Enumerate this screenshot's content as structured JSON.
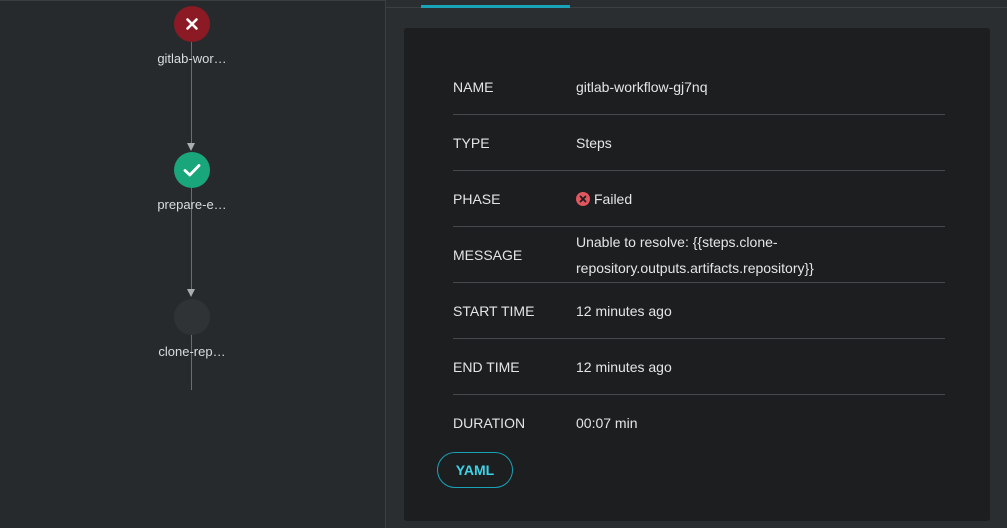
{
  "graph": {
    "nodes": [
      {
        "label": "gitlab-wor…",
        "status": "failed",
        "icon": "close-icon"
      },
      {
        "label": "prepare-e…",
        "status": "succeeded",
        "icon": "check-icon"
      },
      {
        "label": "clone-rep…",
        "status": "pending",
        "icon": "none"
      }
    ]
  },
  "details": {
    "rows": [
      {
        "key": "NAME",
        "value": "gitlab-workflow-gj7nq"
      },
      {
        "key": "TYPE",
        "value": "Steps"
      },
      {
        "key": "PHASE",
        "value": "Failed"
      },
      {
        "key": "MESSAGE",
        "value": "Unable to resolve: {{steps.clone-repository.outputs.artifacts.repository}}"
      },
      {
        "key": "START TIME",
        "value": "12 minutes ago"
      },
      {
        "key": "END TIME",
        "value": "12 minutes ago"
      },
      {
        "key": "DURATION",
        "value": "00:07 min"
      }
    ],
    "yaml_label": "YAML"
  },
  "colors": {
    "failed": "#8b1a24",
    "succeeded": "#19a67a",
    "accent": "#1aa3b8",
    "phase_failed_icon": "#e2565d"
  }
}
